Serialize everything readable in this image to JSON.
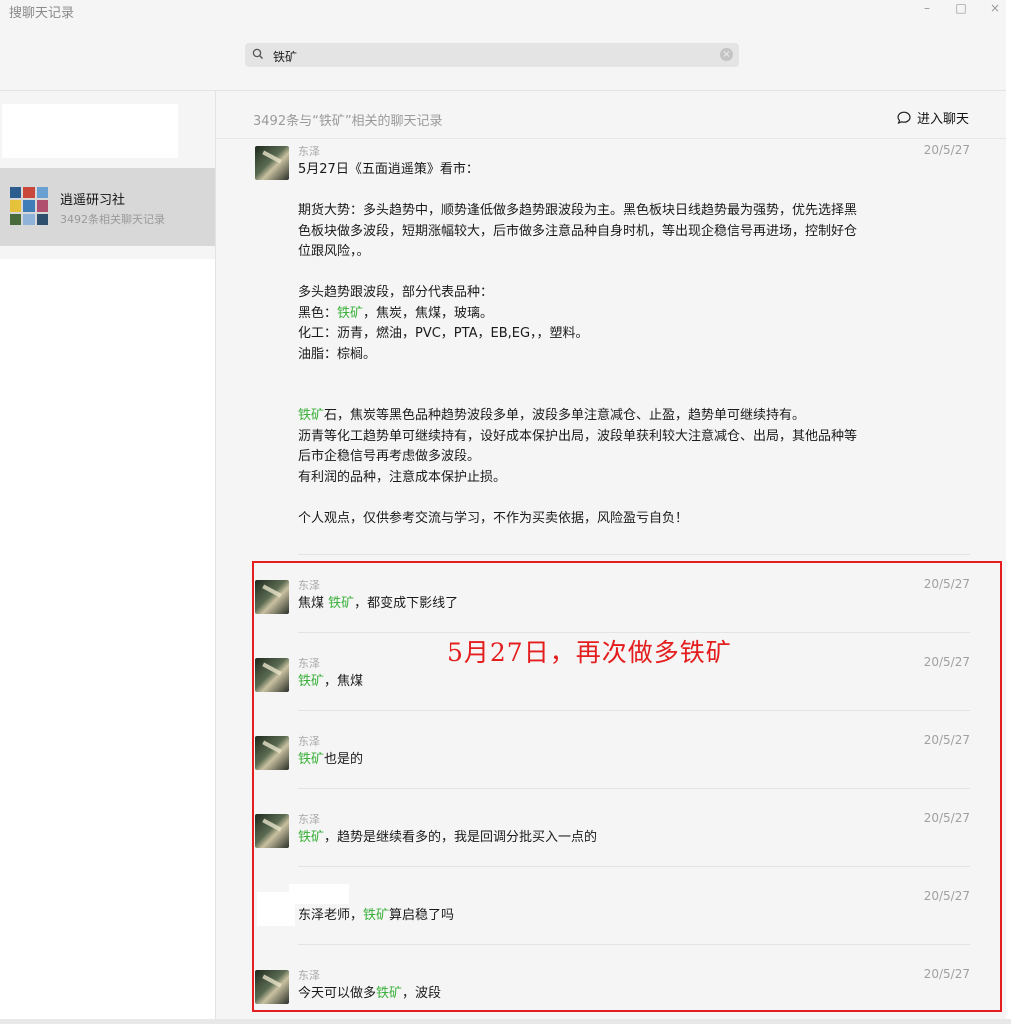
{
  "window": {
    "title": "搜聊天记录",
    "controls": [
      "–",
      "□",
      "×"
    ]
  },
  "search": {
    "value": "铁矿",
    "clear_label": "×"
  },
  "sidebar": {
    "items": [
      {
        "name": "逍遥研习社",
        "subtitle": "3492条相关聊天记录"
      }
    ]
  },
  "results": {
    "count_text": "3492条与“铁矿”相关的聊天记录",
    "enter_chat": "进入聊天"
  },
  "messages": [
    {
      "sender": "东泽",
      "date": "20/5/27",
      "lines": {
        "l1": "5月27日《五面逍遥策》看市：",
        "l2": "期货大势：多头趋势中，顺势逢低做多趋势跟波段为主。黑色板块日线趋势最为强势，优先选择黑",
        "l3": "色板块做多波段，短期涨幅较大，后市做多注意品种自身时机，等出现企稳信号再进场，控制好仓",
        "l4": "位跟风险，。",
        "l5": "多头趋势跟波段，部分代表品种：",
        "l6a": "黑色：",
        "l6b": "铁矿",
        "l6c": "，焦炭，焦煤，玻璃。",
        "l7": "化工：沥青，燃油，PVC，PTA，EB,EG，，塑料。",
        "l8": "油脂：棕榈。",
        "l9a": "铁矿",
        "l9b": "石，焦炭等黑色品种趋势波段多单，波段多单注意减仓、止盈，趋势单可继续持有。",
        "l10": "沥青等化工趋势单可继续持有，设好成本保护出局，波段单获利较大注意减仓、出局，其他品种等",
        "l11": "后市企稳信号再考虑做多波段。",
        "l12": "有利润的品种，注意成本保护止损。",
        "l13": "个人观点，仅供参考交流与学习，不作为买卖依据，风险盈亏自负！"
      }
    },
    {
      "sender": "东泽",
      "date": "20/5/27",
      "pre": "焦煤 ",
      "hl": "铁矿",
      "post": "，都变成下影线了"
    },
    {
      "sender": "东泽",
      "date": "20/5/27",
      "pre": "",
      "hl": "铁矿",
      "post": "，焦煤"
    },
    {
      "sender": "东泽",
      "date": "20/5/27",
      "pre": "",
      "hl": "铁矿",
      "post": "也是的"
    },
    {
      "sender": "东泽",
      "date": "20/5/27",
      "pre": "",
      "hl": "铁矿",
      "post": "，趋势是继续看多的，我是回调分批买入一点的"
    },
    {
      "sender": "",
      "date": "20/5/27",
      "pre": "东泽老师，",
      "hl": "铁矿",
      "post": "算启稳了吗"
    },
    {
      "sender": "东泽",
      "date": "20/5/27",
      "pre": "今天可以做多",
      "hl": "铁矿",
      "post": "，波段"
    }
  ],
  "annotation": {
    "text": "5月27日，再次做多铁矿",
    "color": "#e41e1e"
  },
  "colors": {
    "highlight": "#3ab13a",
    "selected_item": "#d8d8d8",
    "annotation_frame": "#e41e1e"
  }
}
